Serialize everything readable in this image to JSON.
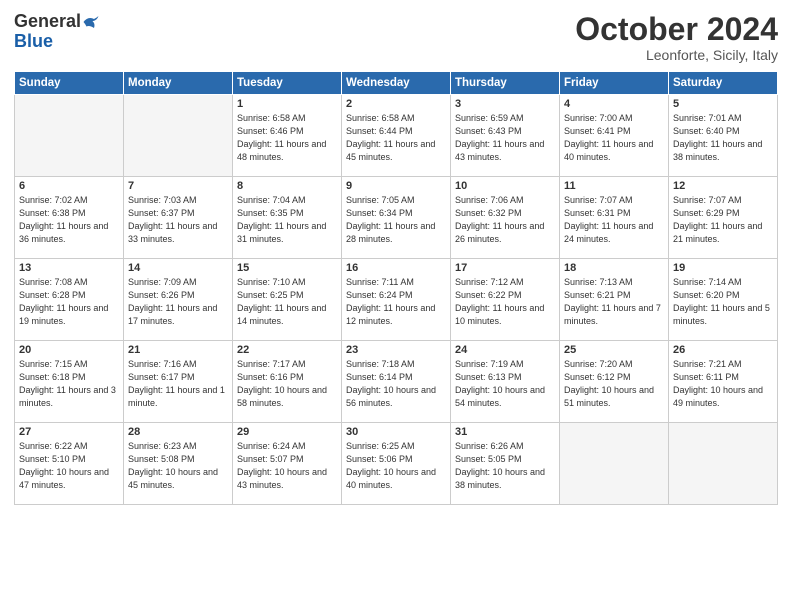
{
  "header": {
    "logo_general": "General",
    "logo_blue": "Blue",
    "month_title": "October 2024",
    "location": "Leonforte, Sicily, Italy"
  },
  "days_of_week": [
    "Sunday",
    "Monday",
    "Tuesday",
    "Wednesday",
    "Thursday",
    "Friday",
    "Saturday"
  ],
  "weeks": [
    [
      {
        "day": "",
        "empty": true
      },
      {
        "day": "",
        "empty": true
      },
      {
        "day": "1",
        "sunrise": "Sunrise: 6:58 AM",
        "sunset": "Sunset: 6:46 PM",
        "daylight": "Daylight: 11 hours and 48 minutes."
      },
      {
        "day": "2",
        "sunrise": "Sunrise: 6:58 AM",
        "sunset": "Sunset: 6:44 PM",
        "daylight": "Daylight: 11 hours and 45 minutes."
      },
      {
        "day": "3",
        "sunrise": "Sunrise: 6:59 AM",
        "sunset": "Sunset: 6:43 PM",
        "daylight": "Daylight: 11 hours and 43 minutes."
      },
      {
        "day": "4",
        "sunrise": "Sunrise: 7:00 AM",
        "sunset": "Sunset: 6:41 PM",
        "daylight": "Daylight: 11 hours and 40 minutes."
      },
      {
        "day": "5",
        "sunrise": "Sunrise: 7:01 AM",
        "sunset": "Sunset: 6:40 PM",
        "daylight": "Daylight: 11 hours and 38 minutes."
      }
    ],
    [
      {
        "day": "6",
        "sunrise": "Sunrise: 7:02 AM",
        "sunset": "Sunset: 6:38 PM",
        "daylight": "Daylight: 11 hours and 36 minutes."
      },
      {
        "day": "7",
        "sunrise": "Sunrise: 7:03 AM",
        "sunset": "Sunset: 6:37 PM",
        "daylight": "Daylight: 11 hours and 33 minutes."
      },
      {
        "day": "8",
        "sunrise": "Sunrise: 7:04 AM",
        "sunset": "Sunset: 6:35 PM",
        "daylight": "Daylight: 11 hours and 31 minutes."
      },
      {
        "day": "9",
        "sunrise": "Sunrise: 7:05 AM",
        "sunset": "Sunset: 6:34 PM",
        "daylight": "Daylight: 11 hours and 28 minutes."
      },
      {
        "day": "10",
        "sunrise": "Sunrise: 7:06 AM",
        "sunset": "Sunset: 6:32 PM",
        "daylight": "Daylight: 11 hours and 26 minutes."
      },
      {
        "day": "11",
        "sunrise": "Sunrise: 7:07 AM",
        "sunset": "Sunset: 6:31 PM",
        "daylight": "Daylight: 11 hours and 24 minutes."
      },
      {
        "day": "12",
        "sunrise": "Sunrise: 7:07 AM",
        "sunset": "Sunset: 6:29 PM",
        "daylight": "Daylight: 11 hours and 21 minutes."
      }
    ],
    [
      {
        "day": "13",
        "sunrise": "Sunrise: 7:08 AM",
        "sunset": "Sunset: 6:28 PM",
        "daylight": "Daylight: 11 hours and 19 minutes."
      },
      {
        "day": "14",
        "sunrise": "Sunrise: 7:09 AM",
        "sunset": "Sunset: 6:26 PM",
        "daylight": "Daylight: 11 hours and 17 minutes."
      },
      {
        "day": "15",
        "sunrise": "Sunrise: 7:10 AM",
        "sunset": "Sunset: 6:25 PM",
        "daylight": "Daylight: 11 hours and 14 minutes."
      },
      {
        "day": "16",
        "sunrise": "Sunrise: 7:11 AM",
        "sunset": "Sunset: 6:24 PM",
        "daylight": "Daylight: 11 hours and 12 minutes."
      },
      {
        "day": "17",
        "sunrise": "Sunrise: 7:12 AM",
        "sunset": "Sunset: 6:22 PM",
        "daylight": "Daylight: 11 hours and 10 minutes."
      },
      {
        "day": "18",
        "sunrise": "Sunrise: 7:13 AM",
        "sunset": "Sunset: 6:21 PM",
        "daylight": "Daylight: 11 hours and 7 minutes."
      },
      {
        "day": "19",
        "sunrise": "Sunrise: 7:14 AM",
        "sunset": "Sunset: 6:20 PM",
        "daylight": "Daylight: 11 hours and 5 minutes."
      }
    ],
    [
      {
        "day": "20",
        "sunrise": "Sunrise: 7:15 AM",
        "sunset": "Sunset: 6:18 PM",
        "daylight": "Daylight: 11 hours and 3 minutes."
      },
      {
        "day": "21",
        "sunrise": "Sunrise: 7:16 AM",
        "sunset": "Sunset: 6:17 PM",
        "daylight": "Daylight: 11 hours and 1 minute."
      },
      {
        "day": "22",
        "sunrise": "Sunrise: 7:17 AM",
        "sunset": "Sunset: 6:16 PM",
        "daylight": "Daylight: 10 hours and 58 minutes."
      },
      {
        "day": "23",
        "sunrise": "Sunrise: 7:18 AM",
        "sunset": "Sunset: 6:14 PM",
        "daylight": "Daylight: 10 hours and 56 minutes."
      },
      {
        "day": "24",
        "sunrise": "Sunrise: 7:19 AM",
        "sunset": "Sunset: 6:13 PM",
        "daylight": "Daylight: 10 hours and 54 minutes."
      },
      {
        "day": "25",
        "sunrise": "Sunrise: 7:20 AM",
        "sunset": "Sunset: 6:12 PM",
        "daylight": "Daylight: 10 hours and 51 minutes."
      },
      {
        "day": "26",
        "sunrise": "Sunrise: 7:21 AM",
        "sunset": "Sunset: 6:11 PM",
        "daylight": "Daylight: 10 hours and 49 minutes."
      }
    ],
    [
      {
        "day": "27",
        "sunrise": "Sunrise: 6:22 AM",
        "sunset": "Sunset: 5:10 PM",
        "daylight": "Daylight: 10 hours and 47 minutes."
      },
      {
        "day": "28",
        "sunrise": "Sunrise: 6:23 AM",
        "sunset": "Sunset: 5:08 PM",
        "daylight": "Daylight: 10 hours and 45 minutes."
      },
      {
        "day": "29",
        "sunrise": "Sunrise: 6:24 AM",
        "sunset": "Sunset: 5:07 PM",
        "daylight": "Daylight: 10 hours and 43 minutes."
      },
      {
        "day": "30",
        "sunrise": "Sunrise: 6:25 AM",
        "sunset": "Sunset: 5:06 PM",
        "daylight": "Daylight: 10 hours and 40 minutes."
      },
      {
        "day": "31",
        "sunrise": "Sunrise: 6:26 AM",
        "sunset": "Sunset: 5:05 PM",
        "daylight": "Daylight: 10 hours and 38 minutes."
      },
      {
        "day": "",
        "empty": true
      },
      {
        "day": "",
        "empty": true
      }
    ]
  ]
}
